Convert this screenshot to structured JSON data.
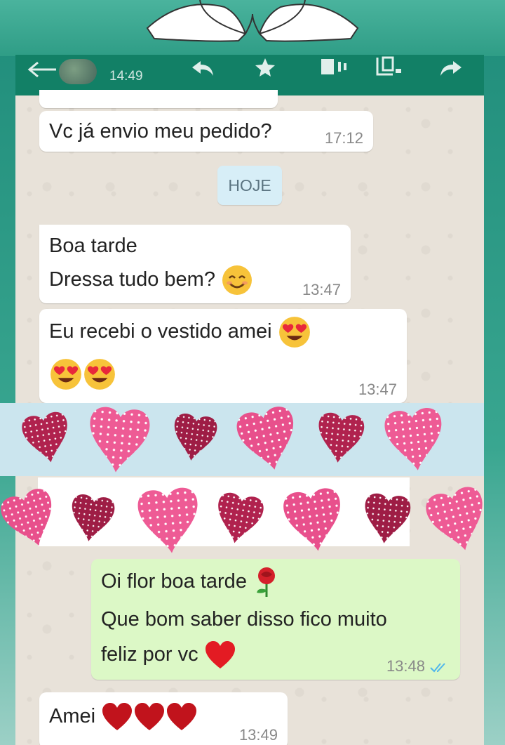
{
  "status_bar": {
    "time": "14:49"
  },
  "chat": {
    "messages": [
      {
        "text": "Vc já envio meu pedido?",
        "time": "17:12"
      },
      {
        "line1": "Boa tarde",
        "line2": "Dressa tudo bem?",
        "emoji": "smiling-face",
        "time": "13:47"
      },
      {
        "line1": "Eu recebi o vestido amei",
        "emoji": "heart-eyes-face",
        "time": "13:47"
      },
      {
        "line1": "Oi flor boa tarde",
        "line2": "Que bom saber disso fico muito",
        "line3": "feliz por vc",
        "time": "13:48",
        "status": "read"
      },
      {
        "text": "Amei",
        "emoji": "red-heart",
        "time": "13:49"
      }
    ],
    "date_chip": "HOJE"
  },
  "colors": {
    "app_bar": "#128066",
    "outgoing_bubble": "#dcf8c6",
    "incoming_bubble": "#ffffff",
    "date_chip": "#d7eef7",
    "read_ticks": "#4fb6ec"
  }
}
